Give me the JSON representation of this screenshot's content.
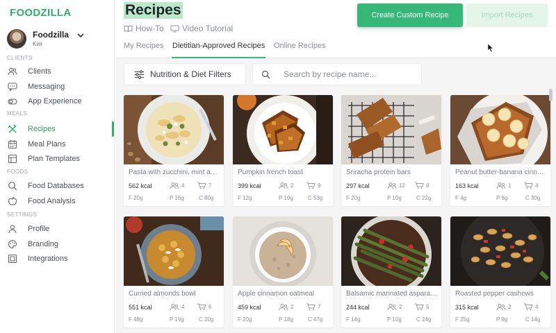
{
  "brand": {
    "logo": "FOODZILLA"
  },
  "account": {
    "name": "Foodzilla",
    "sub": "Kim"
  },
  "sidebar": {
    "sections": [
      {
        "label": "CLIENTS",
        "items": [
          {
            "label": "Clients",
            "icon": "users-icon"
          },
          {
            "label": "Messaging",
            "icon": "chat-icon"
          },
          {
            "label": "App Experience",
            "icon": "toggle-icon"
          }
        ]
      },
      {
        "label": "MEALS",
        "items": [
          {
            "label": "Recipes",
            "icon": "utensils-icon",
            "active": true
          },
          {
            "label": "Meal Plans",
            "icon": "calendar-icon"
          },
          {
            "label": "Plan Templates",
            "icon": "template-icon"
          }
        ]
      },
      {
        "label": "FOODS",
        "items": [
          {
            "label": "Food Databases",
            "icon": "search-icon"
          },
          {
            "label": "Food Analysis",
            "icon": "apple-icon"
          }
        ]
      },
      {
        "label": "SETTINGS",
        "items": [
          {
            "label": "Profile",
            "icon": "user-icon"
          },
          {
            "label": "Branding",
            "icon": "palette-icon"
          },
          {
            "label": "Integrations",
            "icon": "integrations-icon"
          }
        ]
      }
    ]
  },
  "header": {
    "title": "Recipes",
    "links": [
      "How-To",
      "Video Tutorial"
    ],
    "create_button": "Create Custom Recipe",
    "import_button": "Import Recipes",
    "tabs": [
      "My Recipes",
      "Dietitian-Approved Recipes",
      "Online Recipes"
    ],
    "active_tab": 1
  },
  "toolbar": {
    "filters_label": "Nutrition & Diet Filters",
    "search_placeholder": "Search by recipe name..."
  },
  "recipes": [
    {
      "name": "Pasta with zucchini, mint and feta",
      "kcal": "562 kcal",
      "servings": "4",
      "ingredients": "7",
      "fat": "F 20g",
      "protein": "P 16g",
      "carbs": "C 80g"
    },
    {
      "name": "Pumpkin french toast",
      "kcal": "399 kcal",
      "servings": "2",
      "ingredients": "9",
      "fat": "F 12g",
      "protein": "P 19g",
      "carbs": "C 53g"
    },
    {
      "name": "Sriracha protein bars",
      "kcal": "297 kcal",
      "servings": "12",
      "ingredients": "8",
      "fat": "F 20g",
      "protein": "P 10g",
      "carbs": "C 22g"
    },
    {
      "name": "Peanut butter-banana cinnamon toast",
      "kcal": "163 kcal",
      "servings": "1",
      "ingredients": "4",
      "fat": "F 4g",
      "protein": "P 6g",
      "carbs": "C 30g"
    },
    {
      "name": "Curried almonds bowl",
      "kcal": "551 kcal",
      "servings": "4",
      "ingredients": "6",
      "fat": "F 48g",
      "protein": "P 19g",
      "carbs": "C 20g"
    },
    {
      "name": "Apple cinnamon oatmeal",
      "kcal": "459 kcal",
      "servings": "2",
      "ingredients": "7",
      "fat": "F 20g",
      "protein": "P 18g",
      "carbs": "C 47g"
    },
    {
      "name": "Balsamic marinated asparagus",
      "kcal": "244 kcal",
      "servings": "2",
      "ingredients": "5",
      "fat": "F 14g",
      "protein": "P 10g",
      "carbs": "C 24g"
    },
    {
      "name": "Roasted pepper cashews",
      "kcal": "315 kcal",
      "servings": "2",
      "ingredients": "4",
      "fat": "F 25g",
      "protein": "P 9g",
      "carbs": "C 14g"
    }
  ],
  "colors": {
    "accent": "#35b878",
    "active_text": "#2e9f61",
    "title_highlight": "#b9e8cb"
  }
}
